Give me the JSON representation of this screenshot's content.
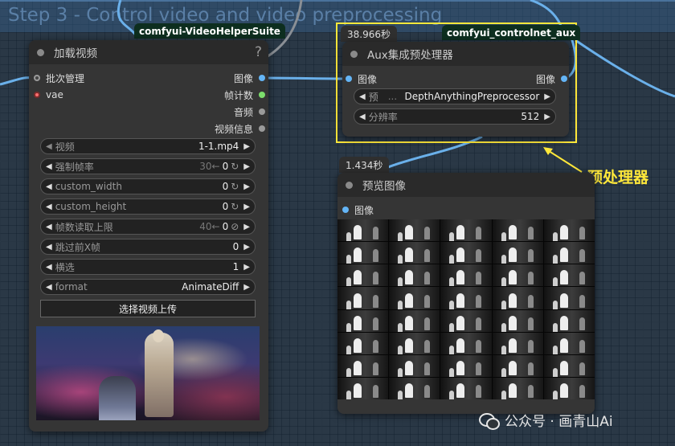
{
  "group": {
    "title": "Step 3 - Control video and video preprocessing"
  },
  "colors": {
    "port_image": "#64b5f6",
    "port_vae": "#ff6e6e",
    "port_int": "#7cdd6c",
    "port_gray": "#9a9a9a",
    "highlight": "#ffe83a",
    "suite_badge_bg": "#0d2e1f"
  },
  "load_video_node": {
    "title": "加载视频",
    "help_icon": "?",
    "suite_badge": "comfyui-VideoHelperSuite",
    "inputs": [
      "批次管理",
      "vae"
    ],
    "outputs": [
      "图像",
      "帧计数",
      "音频",
      "视频信息"
    ],
    "widgets": [
      {
        "label": "视频",
        "value": "1-1.mp4"
      },
      {
        "label": "强制帧率",
        "hint": "30←",
        "value": "0",
        "icon": "reset-icon"
      },
      {
        "label": "custom_width",
        "value": "0",
        "icon": "reset-icon"
      },
      {
        "label": "custom_height",
        "value": "0",
        "icon": "reset-icon"
      },
      {
        "label": "帧数读取上限",
        "hint": "40←",
        "value": "0",
        "icon": "disable-icon"
      },
      {
        "label": "跳过前X帧",
        "value": "0"
      },
      {
        "label": "横选",
        "value": "1"
      },
      {
        "label": "format",
        "value": "AnimateDiff"
      }
    ],
    "upload_button": "选择视频上传"
  },
  "aux_node": {
    "timer": "38.966秒",
    "suite_badge": "comfyui_controlnet_aux",
    "title": "Aux集成预处理器",
    "input": "图像",
    "output": "图像",
    "widgets": [
      {
        "label": "预",
        "ellipsis": "...",
        "value": "DepthAnythingPreprocessor"
      },
      {
        "label": "分辨率",
        "value": "512"
      }
    ]
  },
  "preview_node": {
    "timer": "1.434秒",
    "title": "预览图像",
    "input": "图像"
  },
  "annotation": {
    "text": "预处理器"
  },
  "watermark": {
    "text": "公众号 · 画青山Ai"
  }
}
